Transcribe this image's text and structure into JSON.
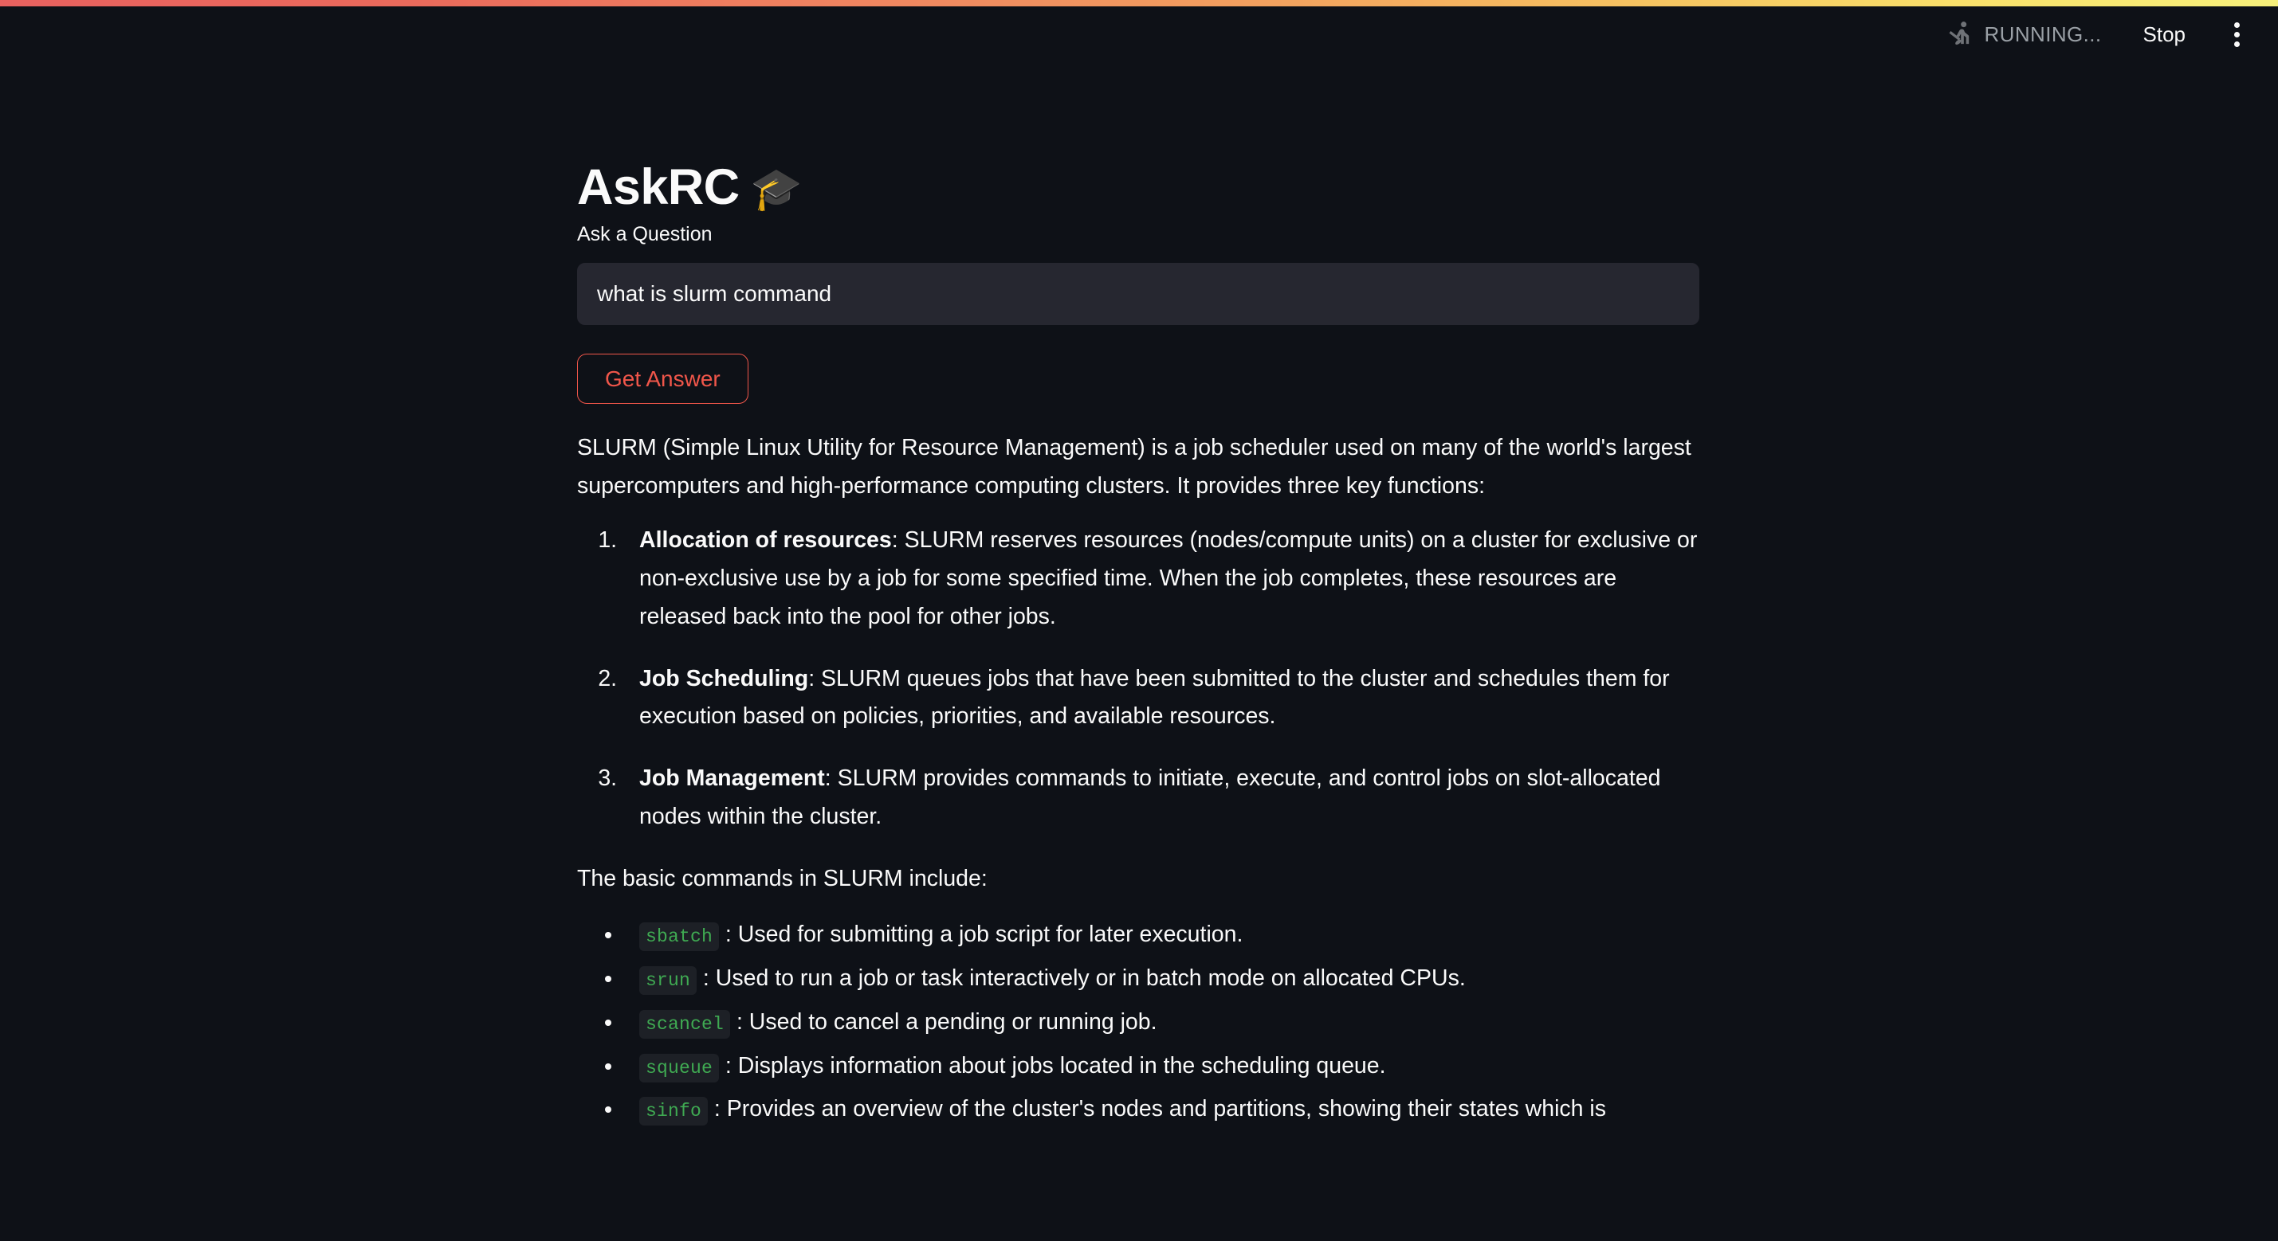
{
  "toolbar": {
    "running_status": "RUNNING...",
    "stop_label": "Stop",
    "running_icon": "running-man-icon",
    "menu_icon": "three-dot-menu-icon"
  },
  "theme": {
    "background": "#0e1117",
    "text": "#fafafa",
    "input_background": "#262730",
    "accent": "#f0564a",
    "code_text": "#3faa52",
    "code_background": "#1d2026",
    "muted_text": "#9aa0a6",
    "gradient_start": "#e8615f",
    "gradient_end": "#f7f17c"
  },
  "page": {
    "title": "AskRC",
    "title_emoji": "🎓"
  },
  "form": {
    "question_label": "Ask a Question",
    "question_value": "what is slurm command",
    "question_placeholder": "",
    "submit_label": "Get Answer"
  },
  "answer": {
    "intro": "SLURM (Simple Linux Utility for Resource Management) is a job scheduler used on many of the world's largest supercomputers and high-performance computing clusters. It provides three key functions:",
    "numbered_items": [
      {
        "term": "Allocation of resources",
        "text": ": SLURM reserves resources (nodes/compute units) on a cluster for exclusive or non-exclusive use by a job for some specified time. When the job completes, these resources are released back into the pool for other jobs."
      },
      {
        "term": "Job Scheduling",
        "text": ": SLURM queues jobs that have been submitted to the cluster and schedules them for execution based on policies, priorities, and available resources."
      },
      {
        "term": "Job Management",
        "text": ": SLURM provides commands to initiate, execute, and control jobs on slot-allocated nodes within the cluster."
      }
    ],
    "lead_in": "The basic commands in SLURM include:",
    "commands": [
      {
        "code": "sbatch",
        "text": ": Used for submitting a job script for later execution."
      },
      {
        "code": "srun",
        "text": ": Used to run a job or task interactively or in batch mode on allocated CPUs."
      },
      {
        "code": "scancel",
        "text": ": Used to cancel a pending or running job."
      },
      {
        "code": "squeue",
        "text": ": Displays information about jobs located in the scheduling queue."
      },
      {
        "code": "sinfo",
        "text": ": Provides an overview of the cluster's nodes and partitions, showing their states which is"
      }
    ]
  }
}
